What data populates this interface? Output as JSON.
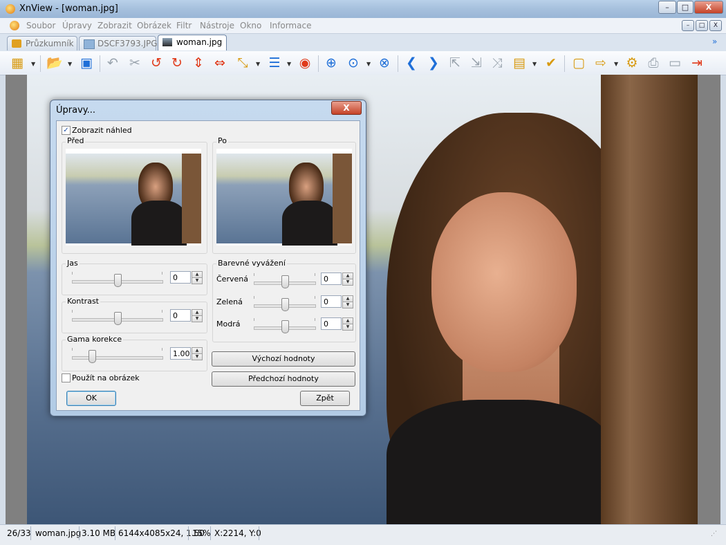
{
  "window": {
    "title": "XnView - [woman.jpg]",
    "buttons": {
      "minimize": "–",
      "maximize": "□",
      "close": "X"
    }
  },
  "menu": {
    "items": [
      "Soubor",
      "Úpravy",
      "Zobrazit",
      "Obrázek",
      "Filtr",
      "Nástroje",
      "Okno",
      "Informace"
    ]
  },
  "tabs": [
    {
      "label": "Průzkumník",
      "active": false
    },
    {
      "label": "DSCF3793.JPG",
      "active": false
    },
    {
      "label": "woman.jpg",
      "active": true
    }
  ],
  "toolbar": {
    "icons": [
      "browser-icon",
      "open-icon",
      "save-icon",
      "undo-icon",
      "cut-icon",
      "rotate-left-icon",
      "rotate-right-icon",
      "flip-vertical-icon",
      "flip-horizontal-icon",
      "resize-icon",
      "adjust-icon",
      "red-eye-icon",
      "zoom-in-icon",
      "zoom-icon",
      "zoom-fit-icon",
      "previous-icon",
      "next-icon",
      "first-icon",
      "last-icon",
      "shuffle-icon",
      "slideshow-icon",
      "favorite-icon",
      "fullscreen-icon",
      "convert-icon",
      "properties-icon",
      "print-icon",
      "scan-icon",
      "export-icon"
    ]
  },
  "status": {
    "index": "26/33",
    "filename": "woman.jpg",
    "size": "3.10 MB",
    "dimensions": "6144x4085x24, 1.50",
    "zoom": "15%",
    "coords": "X:2214, Y:0"
  },
  "dialog": {
    "title": "Úpravy...",
    "show_preview": {
      "label": "Zobrazit náhled",
      "checked": true
    },
    "before_label": "Před",
    "after_label": "Po",
    "brightness": {
      "label": "Jas",
      "value": "0",
      "level": 0.5
    },
    "contrast": {
      "label": "Kontrast",
      "value": "0",
      "level": 0.5
    },
    "gamma": {
      "label": "Gama korekce",
      "value": "1.00",
      "level": 0.2
    },
    "color_balance": {
      "label": "Barevné vyvážení",
      "red": {
        "label": "Červená",
        "value": "0",
        "level": 0.5
      },
      "green": {
        "label": "Zelená",
        "value": "0",
        "level": 0.5
      },
      "blue": {
        "label": "Modrá",
        "value": "0",
        "level": 0.5
      }
    },
    "apply_to_image": {
      "label": "Použít na obrázek",
      "checked": false
    },
    "defaults_button": "Výchozí hodnoty",
    "previous_button": "Předchozí hodnoty",
    "ok_button": "OK",
    "cancel_button": "Zpět"
  }
}
